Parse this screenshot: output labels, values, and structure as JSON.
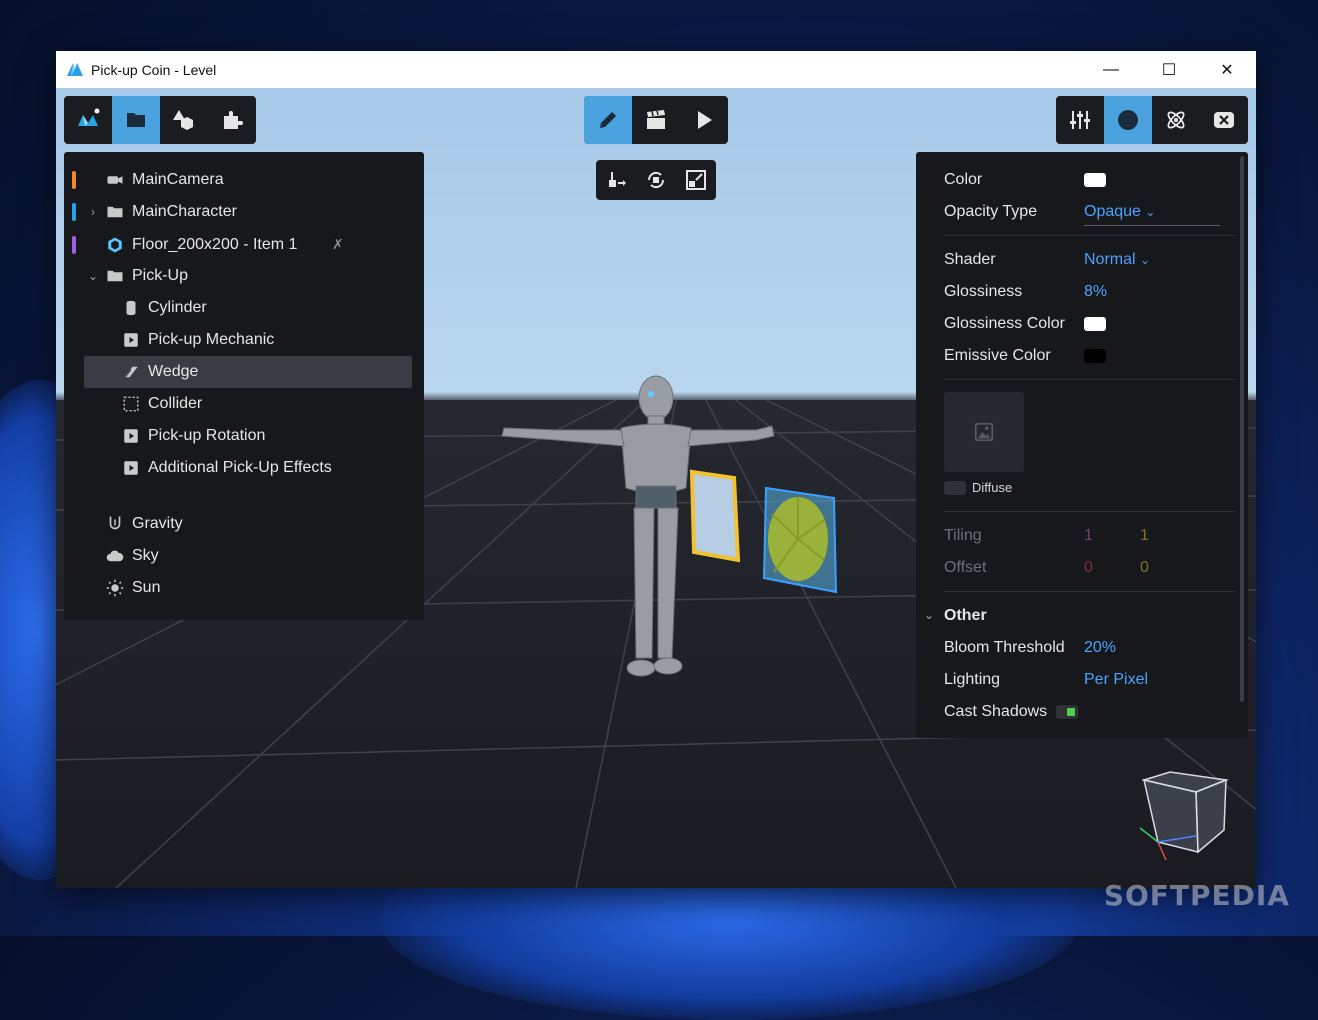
{
  "window": {
    "title": "Pick-up Coin - Level"
  },
  "winbtns": {
    "minimize": "—",
    "maximize": "☐",
    "close": "✕"
  },
  "colors": {
    "accent": "#4aa3df",
    "link": "#4aa3ff",
    "panel": "#17181b"
  },
  "toolbar_left": [
    {
      "name": "logo",
      "icon": "logo-icon",
      "active": false
    },
    {
      "name": "folder",
      "icon": "folder-icon",
      "active": true
    },
    {
      "name": "shapes",
      "icon": "shapes-icon",
      "active": false
    },
    {
      "name": "plugins",
      "icon": "puzzle-icon",
      "active": false
    }
  ],
  "toolbar_center": [
    {
      "name": "edit",
      "icon": "pencil-icon",
      "active": true
    },
    {
      "name": "scene",
      "icon": "clapperboard-icon",
      "active": false
    },
    {
      "name": "play",
      "icon": "play-icon",
      "active": false
    }
  ],
  "toolbar_transform": [
    {
      "name": "move",
      "icon": "move-icon"
    },
    {
      "name": "rotate",
      "icon": "rotate-icon"
    },
    {
      "name": "scale",
      "icon": "scale-icon"
    }
  ],
  "toolbar_right": [
    {
      "name": "settings",
      "icon": "sliders-icon",
      "active": false
    },
    {
      "name": "material",
      "icon": "sphere-icon",
      "active": true
    },
    {
      "name": "physics",
      "icon": "atom-icon",
      "active": false
    },
    {
      "name": "script",
      "icon": "x-badge-icon",
      "active": false
    }
  ],
  "outliner": [
    {
      "label": "MainCamera",
      "icon": "camera-icon",
      "color": "#f08a2a",
      "indent": 0,
      "chevron": ""
    },
    {
      "label": "MainCharacter",
      "icon": "folder-icon",
      "color": "#2aa3e6",
      "indent": 0,
      "chevron": "›"
    },
    {
      "label": "Floor_200x200 - Item 1",
      "icon": "floor-icon",
      "color": "#a05ee0",
      "indent": 0,
      "chevron": ""
    },
    {
      "label": "Pick-Up",
      "icon": "folder-icon",
      "color": "",
      "indent": 0,
      "chevron": "⌄"
    },
    {
      "label": "Cylinder",
      "icon": "cylinder-icon",
      "color": "",
      "indent": 1,
      "chevron": ""
    },
    {
      "label": "Pick-up Mechanic",
      "icon": "script-icon",
      "color": "",
      "indent": 1,
      "chevron": ""
    },
    {
      "label": "Wedge",
      "icon": "wedge-icon",
      "color": "",
      "indent": 1,
      "chevron": "",
      "selected": true
    },
    {
      "label": "Collider",
      "icon": "collider-icon",
      "color": "",
      "indent": 1,
      "chevron": ""
    },
    {
      "label": "Pick-up Rotation",
      "icon": "script-icon",
      "color": "",
      "indent": 1,
      "chevron": ""
    },
    {
      "label": "Additional Pick-Up Effects",
      "icon": "script-icon",
      "color": "",
      "indent": 1,
      "chevron": ""
    },
    {
      "label": "Gravity",
      "icon": "gravity-icon",
      "color": "",
      "indent": 0,
      "chevron": ""
    },
    {
      "label": "Sky",
      "icon": "cloud-icon",
      "color": "",
      "indent": 0,
      "chevron": ""
    },
    {
      "label": "Sun",
      "icon": "sun-icon",
      "color": "",
      "indent": 0,
      "chevron": ""
    }
  ],
  "props": {
    "color": {
      "label": "Color",
      "value": "#ffffff"
    },
    "opacity_type": {
      "label": "Opacity Type",
      "value": "Opaque"
    },
    "shader": {
      "label": "Shader",
      "value": "Normal"
    },
    "glossiness": {
      "label": "Glossiness",
      "value": "8%"
    },
    "glossiness_color": {
      "label": "Glossiness Color",
      "value": "#ffffff"
    },
    "emissive_color": {
      "label": "Emissive Color",
      "value": "#000000"
    },
    "diffuse": {
      "label": "Diffuse"
    },
    "tiling": {
      "label": "Tiling",
      "x": "1",
      "y": "1"
    },
    "offset": {
      "label": "Offset",
      "x": "0",
      "y": "0"
    },
    "other": {
      "label": "Other"
    },
    "bloom_threshold": {
      "label": "Bloom Threshold",
      "value": "20%"
    },
    "lighting": {
      "label": "Lighting",
      "value": "Per Pixel"
    },
    "cast_shadows": {
      "label": "Cast Shadows",
      "on": true
    }
  },
  "watermark": "SOFTPEDIA"
}
